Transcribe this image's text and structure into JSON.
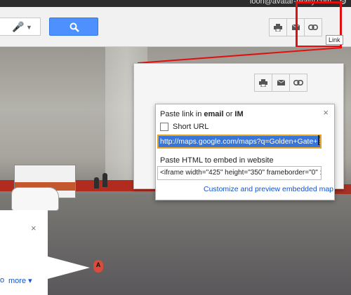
{
  "topbar": {
    "email": "loori@avatar-realty.com"
  },
  "toolbar": {
    "search_placeholder": ""
  },
  "tooltip": {
    "label": "Link"
  },
  "info_panel": {
    "close": "×",
    "more_link": "more ▾",
    "partial_link": "o"
  },
  "marker": {
    "label": "A"
  },
  "dialog": {
    "close": "×",
    "title_prefix": "Paste link in ",
    "title_email": "email",
    "title_or": " or ",
    "title_im": "IM",
    "short_url_label": "Short URL",
    "url_value": "http://maps.google.com/maps?q=Golden+Gate+Bri",
    "embed_label": "Paste HTML to embed in website",
    "embed_value": "<iframe width=\"425\" height=\"350\" frameborder=\"0\" :",
    "customize_link": "Customize and preview embedded map"
  },
  "icons": [
    "print-icon",
    "email-icon",
    "link-icon",
    "search-icon",
    "microphone-icon",
    "gear-icon"
  ],
  "colors": {
    "search_button": "#4d90fe",
    "highlight_box": "#e01010",
    "link": "#1155cc",
    "url_selection": "#3875d7"
  }
}
